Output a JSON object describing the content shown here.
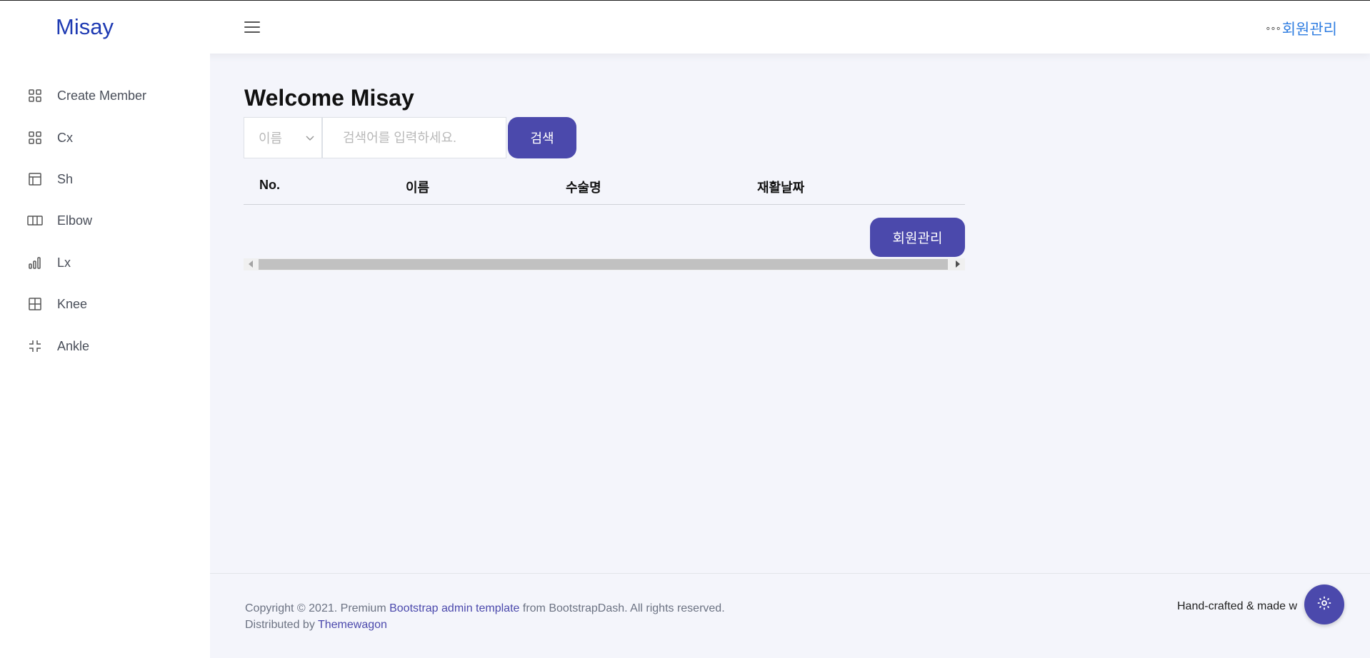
{
  "navbar": {
    "brand": "Misay",
    "right_link": "회원관리",
    "right_dots": "∘∘∘"
  },
  "sidebar": {
    "items": [
      {
        "label": "Create Member",
        "icon": "grid-icon"
      },
      {
        "label": "Cx",
        "icon": "grid-icon"
      },
      {
        "label": "Sh",
        "icon": "layout-icon"
      },
      {
        "label": "Elbow",
        "icon": "columns-icon"
      },
      {
        "label": "Lx",
        "icon": "bar-chart-icon"
      },
      {
        "label": "Knee",
        "icon": "table-icon"
      },
      {
        "label": "Ankle",
        "icon": "minimize-icon"
      }
    ]
  },
  "main": {
    "title": "Welcome Misay",
    "search": {
      "select_value": "이름",
      "placeholder": "검색어를 입력하세요.",
      "button": "검색"
    },
    "table": {
      "headers": [
        "No.",
        "이름",
        "수술명",
        "재활날짜"
      ]
    },
    "manage_button": "회원관리"
  },
  "footer": {
    "copyright_prefix": "Copyright © 2021. Premium ",
    "link1": "Bootstrap admin template",
    "copyright_suffix": " from BootstrapDash. All rights reserved.",
    "distributed_prefix": "Distributed by ",
    "link2": "Themewagon",
    "right_text": "Hand-crafted & made w"
  },
  "colors": {
    "brand": "#1f3bb3",
    "primary": "#4b49ac",
    "link": "#2f7de1",
    "background": "#f4f5fb"
  }
}
